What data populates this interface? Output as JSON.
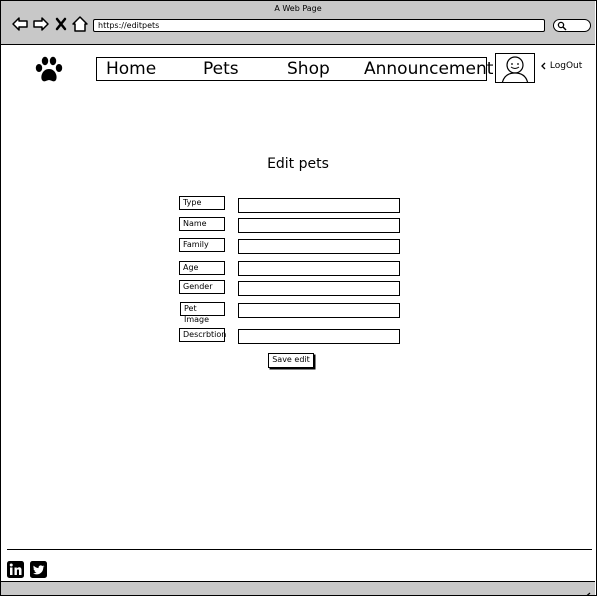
{
  "window": {
    "title": "A Web Page"
  },
  "browser": {
    "url": "https://editpets"
  },
  "nav": {
    "home": "Home",
    "pets": "Pets",
    "shop": "Shop",
    "announcement": "Announcement"
  },
  "user": {
    "logout": "LogOut"
  },
  "form": {
    "heading": "Edit pets",
    "fields": {
      "type": "Type",
      "name": "Name",
      "family": "Family",
      "age": "Age",
      "gender": "Gender",
      "pet_image": "Pet Image",
      "description": "Descrbtion"
    },
    "save_label": "Save edit"
  },
  "footer": {
    "social": [
      "linkedin-icon",
      "twitter-icon"
    ]
  }
}
